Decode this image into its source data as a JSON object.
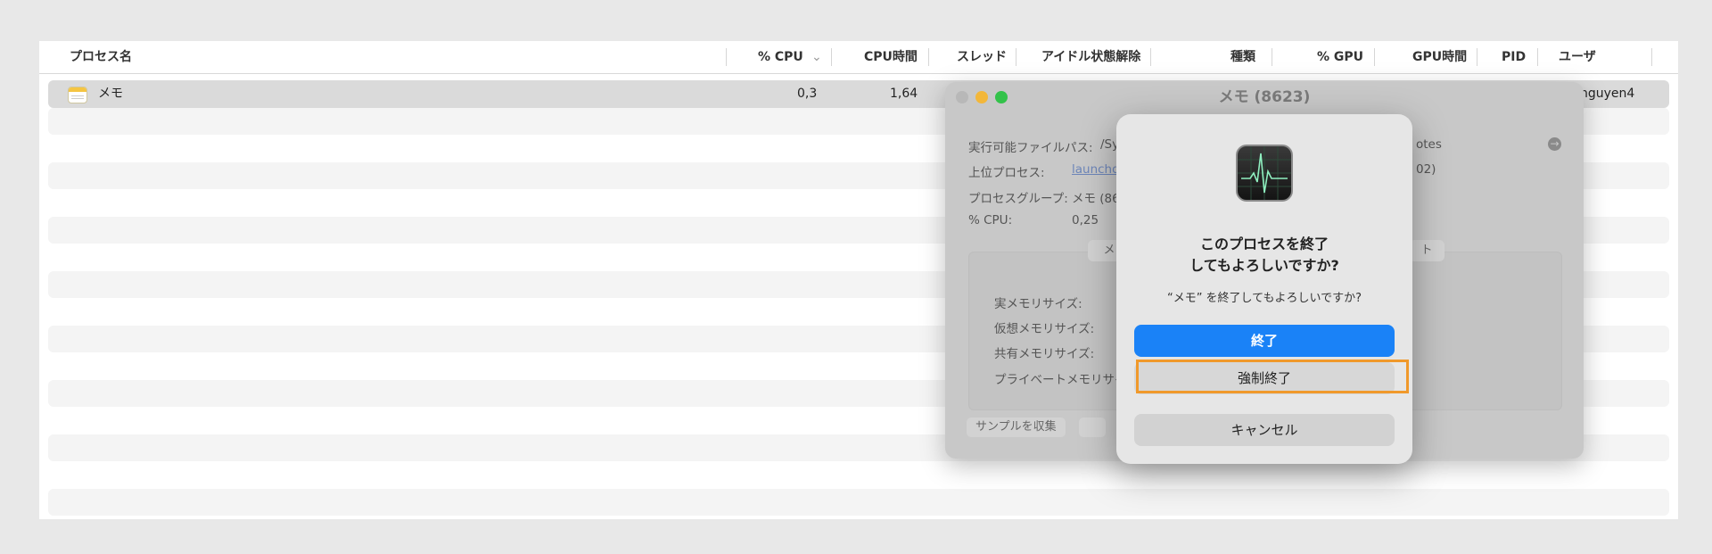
{
  "table": {
    "columns": {
      "name": "プロセス名",
      "cpu": "% CPU",
      "cpu_time": "CPU時間",
      "threads": "スレッド",
      "idle_wakeups": "アイドル状態解除",
      "kind": "種類",
      "gpu": "% GPU",
      "gpu_time": "GPU時間",
      "pid": "PID",
      "user": "ユーザ"
    },
    "sort_indicator": "⌄",
    "selected_row": {
      "name": "メモ",
      "cpu": "0,3",
      "cpu_time": "1,64",
      "user": "nguyen4"
    }
  },
  "info_window": {
    "title": "メモ (8623)",
    "exec_path_label": "実行可能ファイルパス:",
    "exec_path_value": "/Sy",
    "exec_path_tail": "otes",
    "parent_label": "上位プロセス:",
    "parent_value": "launchd",
    "parent_tail": "02)",
    "group_label": "プロセスグループ:",
    "group_value": "メモ (86",
    "cpu_label": "% CPU:",
    "cpu_value": "0,25",
    "tab_memory": "メ",
    "tab_right": "ト",
    "mem_real": "実メモリサイズ:",
    "mem_virtual": "仮想メモリサイズ:",
    "mem_shared": "共有メモリサイズ:",
    "mem_private": "プライベートメモリサイ",
    "sample_button": "サンプルを収集",
    "arrow_icon": "arrow-right-circle-icon"
  },
  "dialog": {
    "title_line1": "このプロセスを終了",
    "title_line2": "してもよろしいですか?",
    "message": "“メモ” を終了してもよろしいですか?",
    "quit": "終了",
    "force_quit": "強制終了",
    "cancel": "キャンセル"
  },
  "colors": {
    "accent": "#1a82f7",
    "highlight": "#f0992b"
  }
}
